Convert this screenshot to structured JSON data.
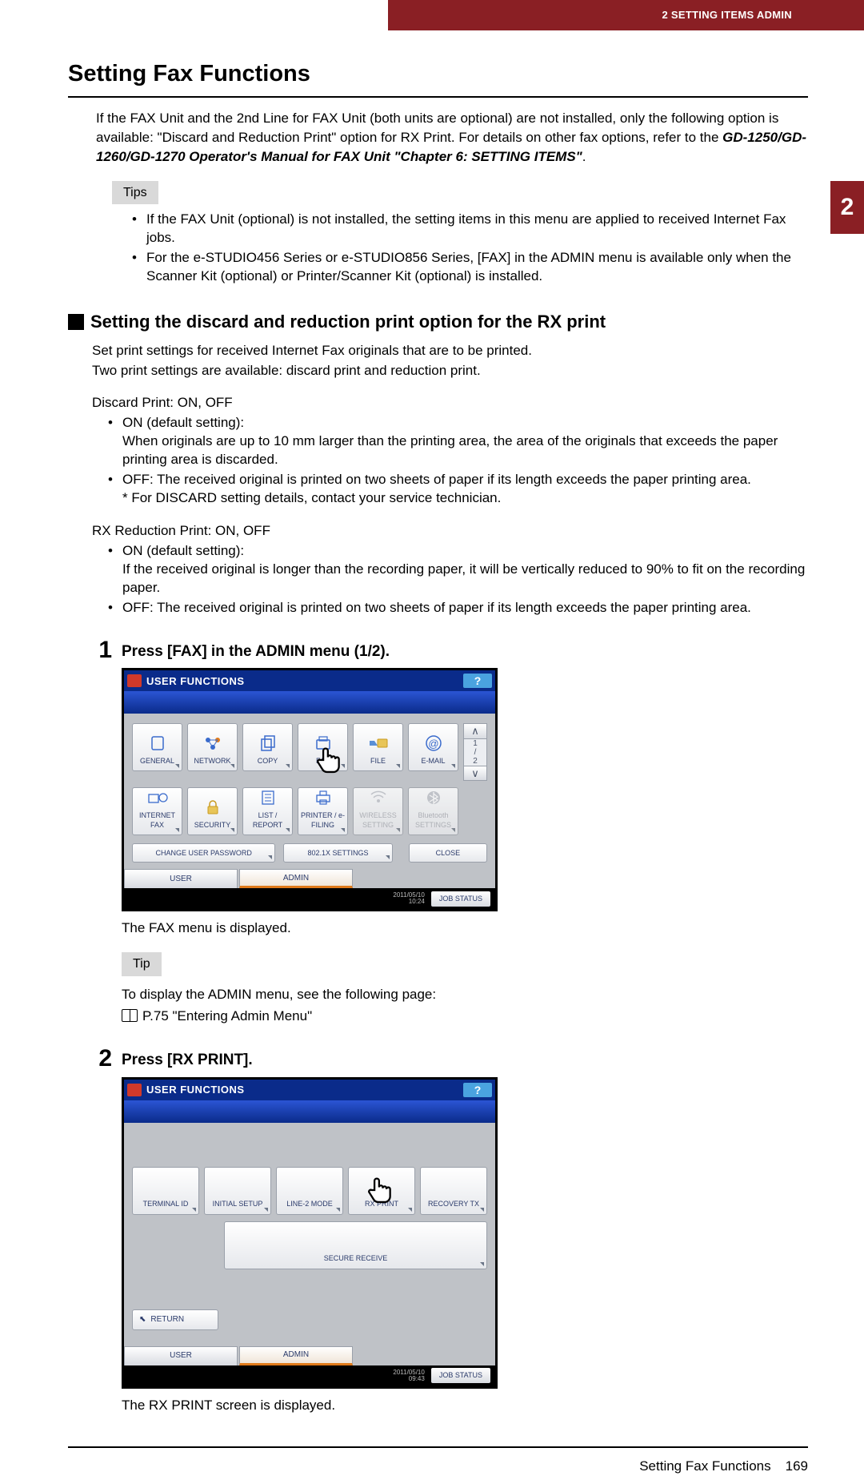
{
  "header": {
    "section": "2 SETTING ITEMS ADMIN",
    "tab": "2"
  },
  "title": "Setting Fax Functions",
  "intro": {
    "p1": "If the FAX Unit and the 2nd Line for FAX Unit (both units are optional) are not installed, only the following option is available: \"Discard and Reduction Print\" option for RX Print. For details on other fax options, refer to the ",
    "ref": "GD-1250/GD-1260/GD-1270 Operator's Manual for FAX Unit \"Chapter 6: SETTING ITEMS\"",
    "p1end": "."
  },
  "tips_label": "Tips",
  "tips": [
    "If the FAX Unit (optional) is not installed, the setting items in this menu are applied to received Internet Fax jobs.",
    "For the e-STUDIO456 Series or e-STUDIO856 Series, [FAX] in the ADMIN menu is available only when the Scanner Kit (optional) or Printer/Scanner Kit (optional) is installed."
  ],
  "subheading": "Setting the discard and reduction print option for the RX print",
  "sec": {
    "p1": "Set print settings for received Internet Fax originals that are to be printed.",
    "p2": "Two print settings are available: discard print and reduction print.",
    "discard_title": "Discard Print: ON, OFF",
    "discard_opts": [
      "ON (default setting):\nWhen originals are up to 10 mm larger than the printing area, the area of the originals that exceeds the paper printing area is discarded.",
      "OFF: The received original is printed on two sheets of paper if its length exceeds the paper printing area.\n* For DISCARD setting details, contact your service technician."
    ],
    "rx_title": "RX Reduction Print: ON, OFF",
    "rx_opts": [
      "ON (default setting):\nIf the received original is longer than the recording paper, it will be vertically reduced to 90% to fit on the recording paper.",
      "OFF: The received original is printed on two sheets of paper if its length exceeds the paper printing area."
    ]
  },
  "step1": {
    "num": "1",
    "title": "Press [FAX] in the ADMIN menu (1/2).",
    "after": "The FAX menu is displayed.",
    "tip_label": "Tip",
    "tip_text": "To display the ADMIN menu, see the following page:",
    "tip_ref": "P.75 \"Entering Admin Menu\"",
    "panel": {
      "title": "USER FUNCTIONS",
      "help": "?",
      "tiles_row1": [
        "GENERAL",
        "NETWORK",
        "COPY",
        "FAX",
        "FILE",
        "E-MAIL"
      ],
      "tiles_row2": [
        "INTERNET FAX",
        "SECURITY",
        "LIST / REPORT",
        "PRINTER / e-FILING",
        "WIRELESS SETTING",
        "Bluetooth SETTINGS"
      ],
      "page_indicator": "1\n/\n2",
      "btn1": "CHANGE USER PASSWORD",
      "btn2": "802.1X SETTINGS",
      "btn_close": "CLOSE",
      "tab_user": "USER",
      "tab_admin": "ADMIN",
      "timestamp": "2011/05/10\n10:24",
      "job": "JOB STATUS"
    }
  },
  "step2": {
    "num": "2",
    "title": "Press [RX PRINT].",
    "after": "The RX PRINT screen is displayed.",
    "panel": {
      "title": "USER FUNCTIONS",
      "help": "?",
      "tiles_row1": [
        "TERMINAL ID",
        "INITIAL SETUP",
        "LINE-2 MODE",
        "RX PRINT",
        "RECOVERY TX"
      ],
      "tiles_row2": [
        "SECURE RECEIVE"
      ],
      "return": "RETURN",
      "tab_user": "USER",
      "tab_admin": "ADMIN",
      "timestamp": "2011/05/10\n09:43",
      "job": "JOB STATUS"
    }
  },
  "footer": {
    "label": "Setting Fax Functions",
    "page": "169"
  }
}
